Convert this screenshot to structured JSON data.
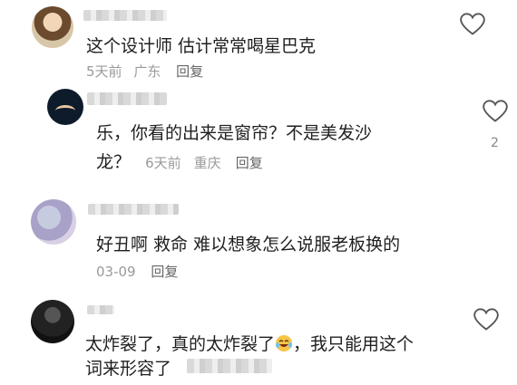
{
  "comments": [
    {
      "text": "这个设计师 估计常常喝星巴克",
      "time": "5天前",
      "location": "广东",
      "reply": "回复"
    },
    {
      "text_line1": "乐，你看的出来是窗帘？不是美发沙",
      "text_line2": "龙？",
      "time": "6天前",
      "location": "重庆",
      "reply": "回复",
      "like_count": "2"
    },
    {
      "text": "好丑啊 救命 难以想象怎么说服老板换的",
      "time": "03-09",
      "reply": "回复"
    },
    {
      "text_line1a": "太炸裂了，真的太炸裂了",
      "text_line1b": "，我只能用这个",
      "text_line2": "词来形容了",
      "emoji_icon": "crying-laughing-emoji"
    }
  ],
  "colors": {
    "meta": "#9a9a9a",
    "text": "#1f1f1f",
    "icon": "#555555"
  }
}
